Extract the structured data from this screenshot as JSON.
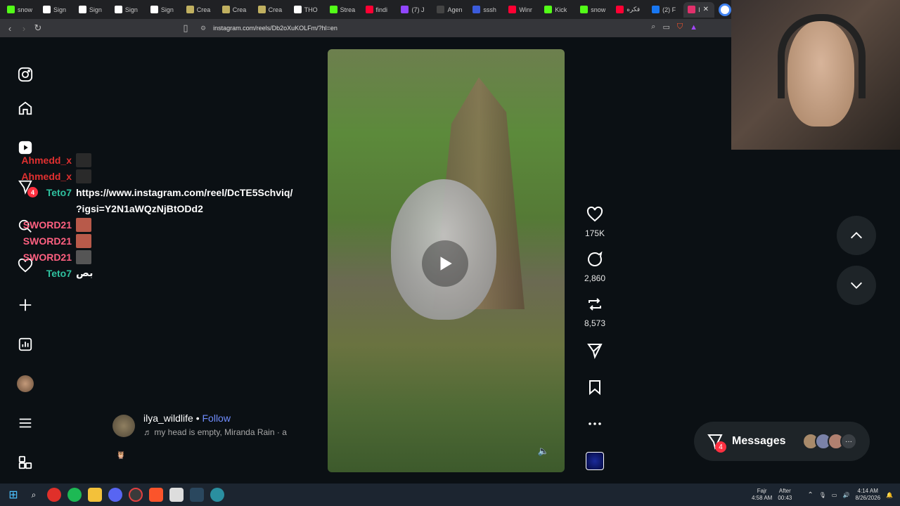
{
  "browser": {
    "tabs": [
      {
        "label": "snow",
        "color": "#53fc18"
      },
      {
        "label": "Sign",
        "color": "#ffffff"
      },
      {
        "label": "Sign",
        "color": "#ffffff"
      },
      {
        "label": "Sign",
        "color": "#ffffff"
      },
      {
        "label": "Sign",
        "color": "#ffffff"
      },
      {
        "label": "Crea",
        "color": "#c0b060"
      },
      {
        "label": "Crea",
        "color": "#c0b060"
      },
      {
        "label": "Crea",
        "color": "#c0b060"
      },
      {
        "label": "THO",
        "color": "#ffffff"
      },
      {
        "label": "Strea",
        "color": "#53fc18"
      },
      {
        "label": "findi",
        "color": "#ff0033"
      },
      {
        "label": "(7) J",
        "color": "#9146ff"
      },
      {
        "label": "Agen",
        "color": "#444444"
      },
      {
        "label": "sssh",
        "color": "#3b5bdb"
      },
      {
        "label": "Winr",
        "color": "#ff0033"
      },
      {
        "label": "Kick",
        "color": "#53fc18"
      },
      {
        "label": "snow",
        "color": "#53fc18"
      },
      {
        "label": "فكره",
        "color": "#ff0033"
      },
      {
        "label": "(2) F",
        "color": "#1877f2"
      },
      {
        "label": "I",
        "color": "#e1306c"
      }
    ],
    "url": "instagram.com/reels/Db2oXuKOLFm/?hl=en"
  },
  "chat": [
    {
      "user": "Ahmedd_x",
      "color": "#e03030",
      "msg": "",
      "emote": "#2a2a2a"
    },
    {
      "user": "Ahmedd_x",
      "color": "#e03030",
      "msg": "",
      "emote": "#2a2a2a"
    },
    {
      "user": "Teto7",
      "color": "#2fc2a0",
      "msg": "https://www.instagram.com/reel/DcTE5Schviq/",
      "emote": ""
    },
    {
      "user": "",
      "color": "#ffffff",
      "msg": "?igsi=Y2N1aWQzNjBtODd2",
      "emote": ""
    },
    {
      "user": "SWORD21",
      "color": "#ff6080",
      "msg": "",
      "emote": "#b85a4a"
    },
    {
      "user": "SWORD21",
      "color": "#ff6080",
      "msg": "",
      "emote": "#b85a4a"
    },
    {
      "user": "SWORD21",
      "color": "#ff6080",
      "msg": "",
      "emote": "#555555"
    },
    {
      "user": "Teto7",
      "color": "#2fc2a0",
      "msg": "بص",
      "emote": ""
    }
  ],
  "nav": {
    "notification_badge": "4"
  },
  "reel": {
    "likes": "175K",
    "comments": "2,860",
    "reposts": "8,573",
    "author": "ilya_wildlife",
    "separator": "•",
    "follow_label": "Follow",
    "song": "my head is empty, Miranda Rain · a",
    "emoji": "🦉"
  },
  "messages": {
    "label": "Messages",
    "badge": "4",
    "more": "···"
  },
  "taskbar": {
    "prayer_name": "Fajr",
    "prayer_time": "4:58 AM",
    "after_label": "After",
    "after_value": "00:43",
    "time": "4:14 AM",
    "date": "8/26/2026"
  }
}
